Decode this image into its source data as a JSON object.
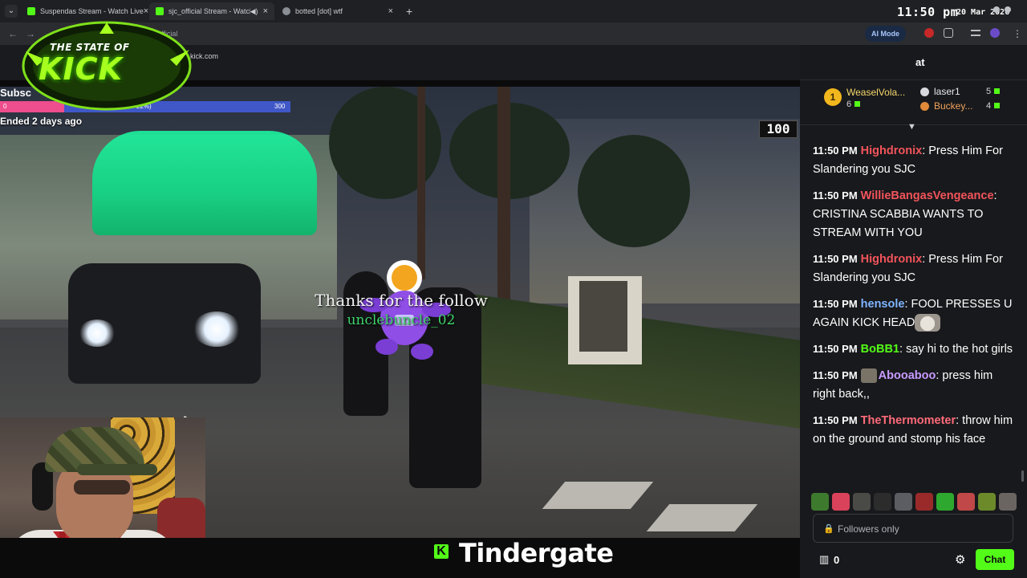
{
  "browser": {
    "tabs": [
      {
        "label": "Suspendas Stream - Watch Live",
        "close": "×"
      },
      {
        "label": "sjc_official Stream - Watch L",
        "close": "×"
      },
      {
        "label": "botted [dot] wtf",
        "close": "×"
      }
    ],
    "new_tab": "+",
    "tab_search": "⌄",
    "address": "official",
    "ai_mode": "AI Mode",
    "site_url": "kick.com"
  },
  "overlay": {
    "clock": "11:50 pm",
    "date": "20 Mar 2026",
    "logo_top": "THE STATE OF",
    "logo_main": "KICK",
    "banner_title": "Tindergate",
    "banner_icon": "K"
  },
  "stream": {
    "sub_goal_title": "Subsc",
    "sub_goal_start": "0",
    "sub_goal_percent": "22%)",
    "sub_goal_target": "300",
    "sub_goal_progress": 0.22,
    "ended": "Ended 2 days ago",
    "counter": "100",
    "follow_alert_text": "Thanks for the follow",
    "follow_alert_user": "unclebuncle_02"
  },
  "chat": {
    "header_label": "at",
    "leaderboard": [
      {
        "rank": "1",
        "name": "WeaselVola...",
        "count": "6"
      },
      {
        "name": "laser1",
        "count": "5"
      },
      {
        "name": "Buckey...",
        "count": "4"
      }
    ],
    "messages": [
      {
        "time": "11:50 PM",
        "user": "Highdronix",
        "color": "#f2545b",
        "text": "Press Him For Slandering you SJC"
      },
      {
        "time": "11:50 PM",
        "user": "WillieBangasVengeance",
        "color": "#f2545b",
        "text": "CRISTINA SCABBIA WANTS TO STREAM WITH YOU"
      },
      {
        "time": "11:50 PM",
        "user": "Highdronix",
        "color": "#f2545b",
        "text": "Press Him For Slandering you SJC"
      },
      {
        "time": "11:50 PM",
        "user": "hensole",
        "color": "#7fb4ff",
        "text": "FOOL PRESSES U AGAIN KICK HEAD"
      },
      {
        "time": "11:50 PM",
        "user": "BoBB1",
        "color": "#53fc18",
        "text": "say hi to the hot girls"
      },
      {
        "time": "11:50 PM",
        "user": "Abooaboo",
        "color": "#c89bff",
        "text": "press him right back,,"
      },
      {
        "time": "11:50 PM",
        "user": "TheThermometer",
        "color": "#ff6b7a",
        "text": "throw him on the ground and stomp his face"
      }
    ],
    "input_placeholder": "Followers only",
    "points": "0",
    "chat_button": "Chat"
  },
  "colors": {
    "kick_green": "#53fc18",
    "goal_pink": "#ee4d8e",
    "goal_blue": "#4058c7",
    "chat_bg": "#18191c"
  }
}
